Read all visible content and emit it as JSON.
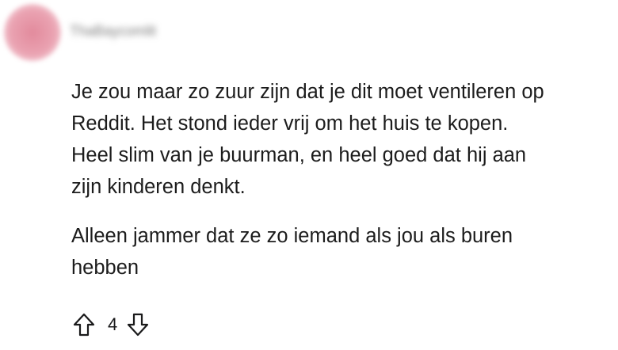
{
  "comment": {
    "author": "ThaBaycomlit",
    "paragraphs": [
      "Je zou maar zo zuur zijn dat je dit moet ventileren op\nReddit. Het stond ieder vrij om het huis te kopen.\nHeel slim van je buurman, en heel goed dat hij aan\nzijn kinderen denkt.",
      "Alleen jammer dat ze zo iemand als jou als buren\nhebben"
    ],
    "score": "4"
  },
  "icons": {
    "upvote": "arrow-up-outline-icon",
    "downvote": "arrow-down-outline-icon"
  },
  "colors": {
    "avatar": "#e99aab",
    "text": "#1c1c1c",
    "icon_stroke": "#1a1a1b"
  }
}
